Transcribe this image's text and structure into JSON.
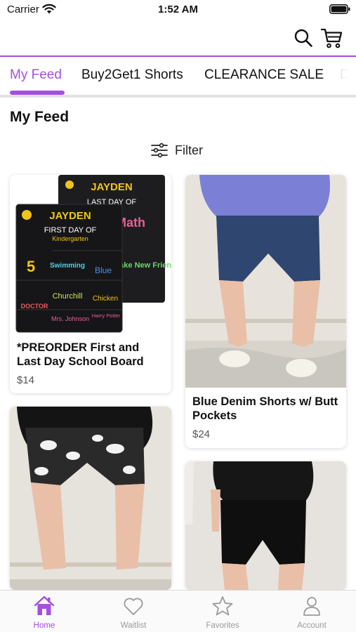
{
  "status_bar": {
    "carrier": "Carrier",
    "time": "1:52 AM"
  },
  "colors": {
    "accent": "#a54fe0",
    "text": "#111111",
    "muted": "#9a9a9a"
  },
  "header": {
    "icons": [
      "search-icon",
      "cart-icon"
    ]
  },
  "tabs": [
    {
      "label": "My Feed",
      "active": true
    },
    {
      "label": "Buy2Get1 Shorts",
      "active": false
    },
    {
      "label": "CLEARANCE SALE",
      "active": false
    },
    {
      "label": "D",
      "active": false
    }
  ],
  "feed": {
    "title": "My Feed",
    "filter_label": "Filter"
  },
  "products": [
    {
      "title": "*PREORDER First and Last Day School Board",
      "price": "$14",
      "board": {
        "name": "JAYDEN",
        "front_caption": "FIRST DAY OF",
        "back_caption": "LAST DAY OF",
        "grade": "Kindergarten",
        "age": "5",
        "activity": "Swimming",
        "color": "Blue",
        "teacher": "Mrs. Johnson",
        "school": "Churchill",
        "food": "Chicken",
        "book": "Harry Potter",
        "job": "DOCTOR",
        "summer": "Make New Friends",
        "subject": "Math"
      }
    },
    {
      "title": "Blue Denim Shorts w/ Butt Pockets",
      "price": "$24"
    },
    {
      "title": "",
      "price": ""
    },
    {
      "title": "",
      "price": ""
    }
  ],
  "bottom_nav": [
    {
      "label": "Home",
      "icon": "home-icon",
      "active": true
    },
    {
      "label": "Waitlist",
      "icon": "heart-icon",
      "active": false
    },
    {
      "label": "Favorites",
      "icon": "star-icon",
      "active": false
    },
    {
      "label": "Account",
      "icon": "person-icon",
      "active": false
    }
  ]
}
